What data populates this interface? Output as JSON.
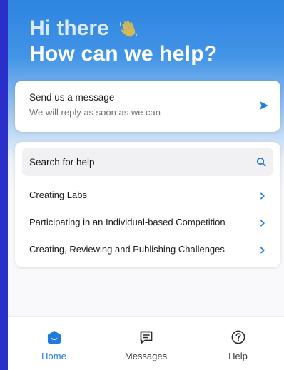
{
  "header": {
    "greeting": "Hi there",
    "wave_emoji": "👋",
    "headline": "How can we help?"
  },
  "message_card": {
    "title": "Send us a message",
    "subtitle": "We will reply as soon as we can",
    "icon": "send-icon"
  },
  "help": {
    "search_label": "Search for help",
    "search_icon": "search-icon",
    "items": [
      {
        "label": "Creating Labs"
      },
      {
        "label": "Participating in an Individual-based Competition"
      },
      {
        "label": "Creating, Reviewing and Publishing Challenges"
      }
    ]
  },
  "nav": {
    "items": [
      {
        "label": "Home",
        "icon": "home-icon",
        "active": true
      },
      {
        "label": "Messages",
        "icon": "chat-icon",
        "active": false
      },
      {
        "label": "Help",
        "icon": "help-circle-icon",
        "active": false
      }
    ]
  },
  "colors": {
    "page_background": "#2b2fc9",
    "accent": "#1f7ae0",
    "header_gradient_top": "#2d84e0",
    "text_primary": "#1a1a1a",
    "text_secondary": "#737376"
  }
}
